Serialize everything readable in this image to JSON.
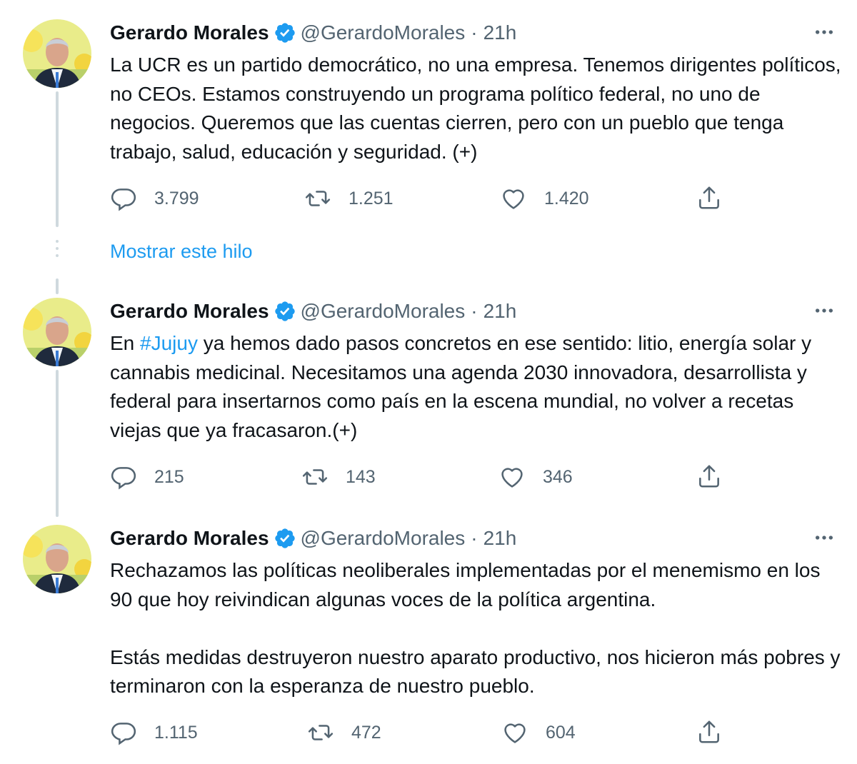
{
  "thread_link": "Mostrar este hilo",
  "tweets": [
    {
      "name": "Gerardo Morales",
      "handle": "@GerardoMorales",
      "separator": "·",
      "time": "21h",
      "text": "La UCR es un partido democrático, no una empresa. Tenemos dirigentes políticos, no CEOs. Estamos construyendo un programa político federal, no uno de negocios. Queremos que las cuentas cierren, pero con un pueblo que tenga trabajo, salud, educación y seguridad. (+)",
      "replies": "3.799",
      "retweets": "1.251",
      "likes": "1.420"
    },
    {
      "name": "Gerardo Morales",
      "handle": "@GerardoMorales",
      "separator": "·",
      "time": "21h",
      "text_before": "En ",
      "hashtag": "#Jujuy",
      "text_after": " ya hemos dado pasos concretos en ese sentido: litio, energía solar y cannabis medicinal. Necesitamos una agenda 2030 innovadora, desarrollista y federal para insertarnos como país en la escena mundial, no volver a recetas viejas que ya fracasaron.(+)",
      "replies": "215",
      "retweets": "143",
      "likes": "346"
    },
    {
      "name": "Gerardo Morales",
      "handle": "@GerardoMorales",
      "separator": "·",
      "time": "21h",
      "text_p1": "Rechazamos las políticas neoliberales implementadas por el menemismo en los 90 que hoy reivindican algunas voces de la política argentina.",
      "text_p2": "Estás medidas destruyeron nuestro aparato productivo, nos hicieron más pobres y terminaron con la esperanza de nuestro pueblo.",
      "replies": "1.115",
      "retweets": "472",
      "likes": "604"
    }
  ],
  "icons": {
    "verified": "verified-badge-icon",
    "more": "more-options-icon",
    "reply": "reply-icon",
    "retweet": "retweet-icon",
    "like": "like-icon",
    "share": "share-icon"
  },
  "colors": {
    "accent": "#1d9bf0",
    "text": "#0f1419",
    "secondary": "#536471",
    "thread_line": "#cfd9de"
  }
}
